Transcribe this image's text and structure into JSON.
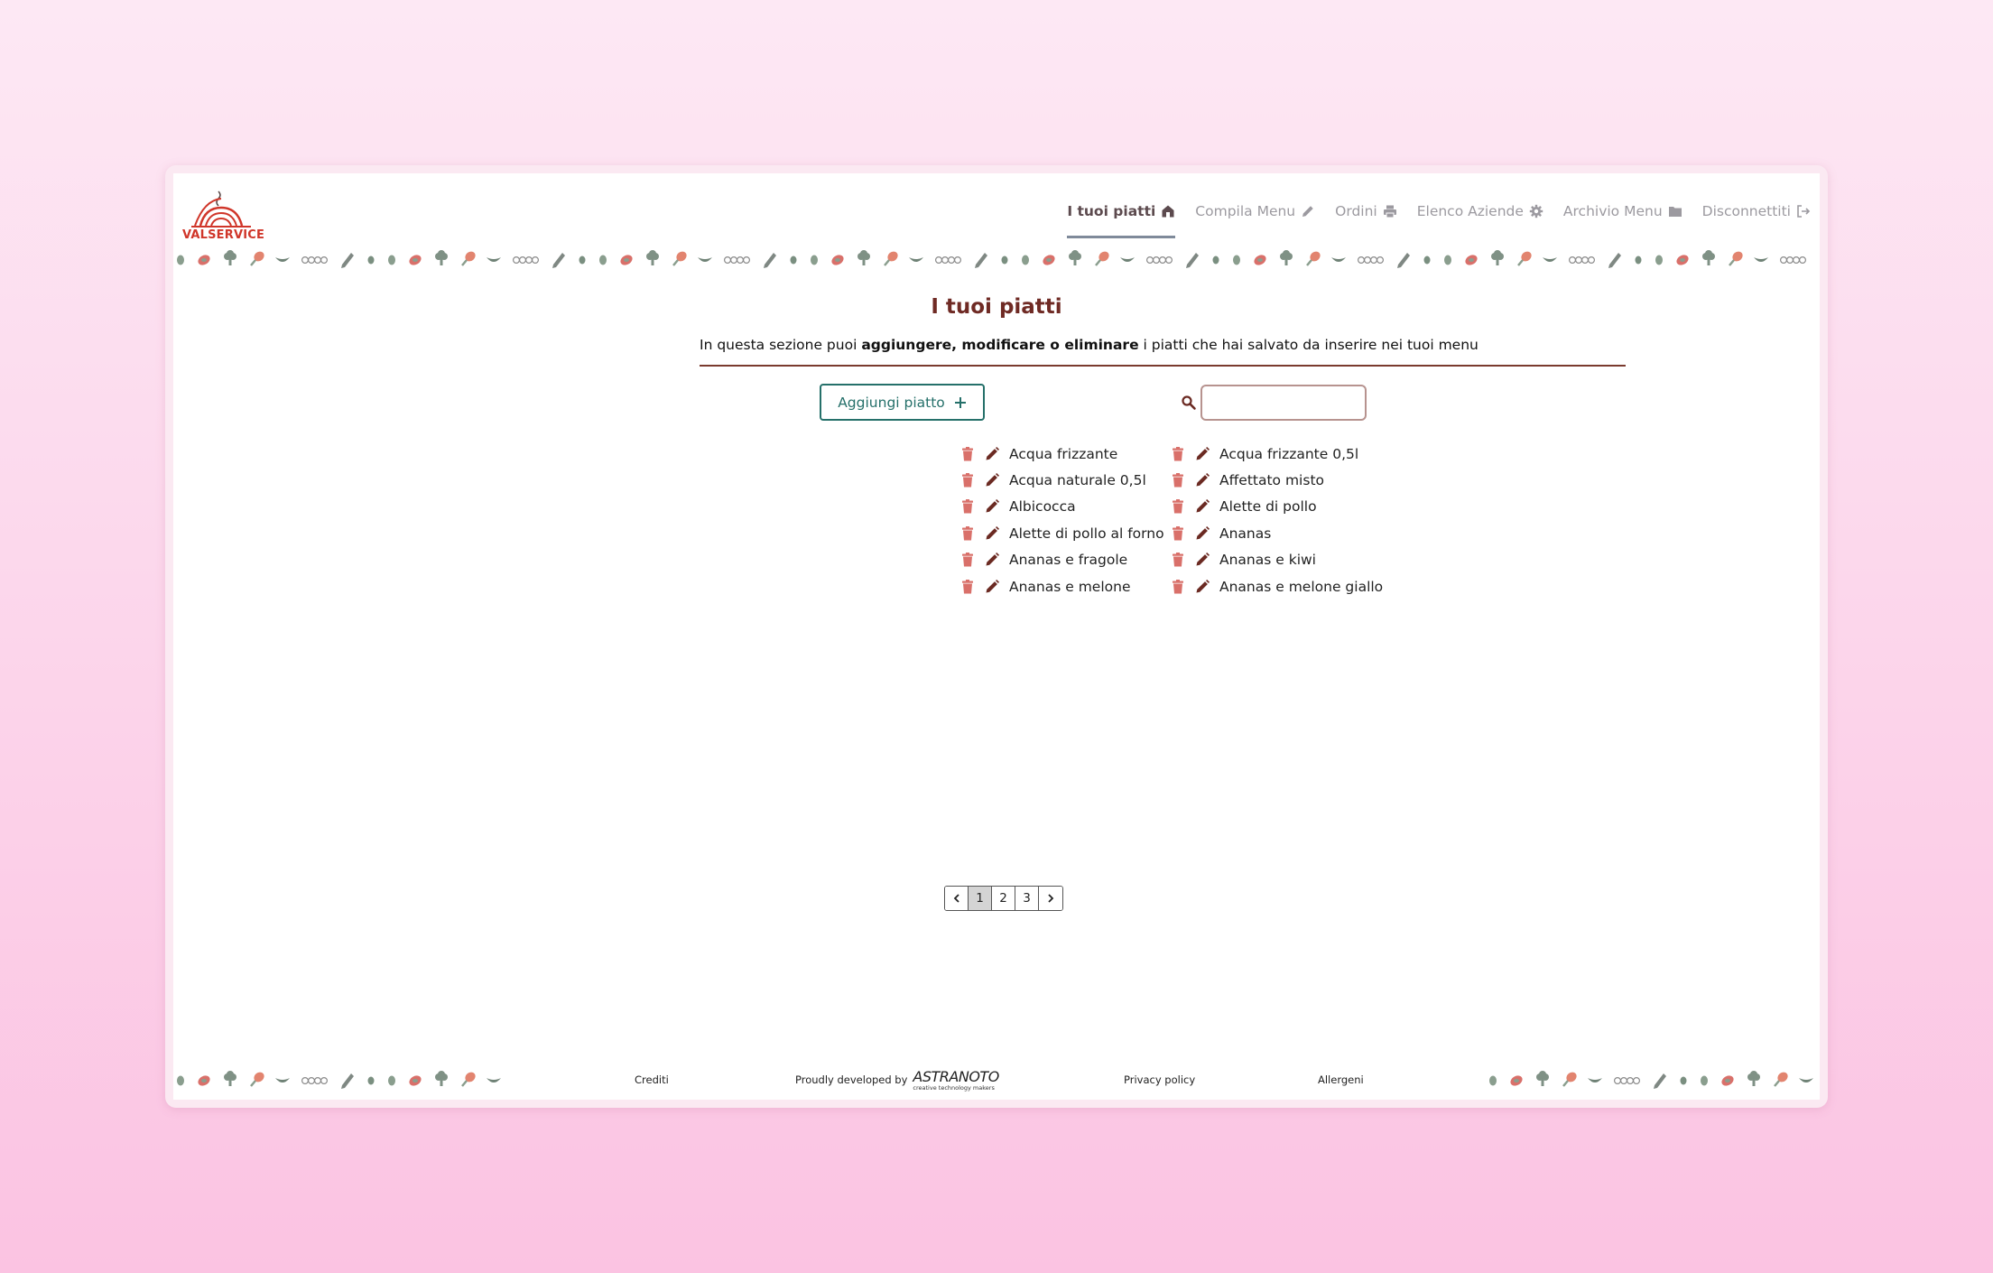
{
  "brand": {
    "name": "VALSERVICE"
  },
  "nav": [
    {
      "label": "I tuoi piatti",
      "icon": "home-icon",
      "active": true
    },
    {
      "label": "Compila Menu",
      "icon": "pencil-icon",
      "active": false
    },
    {
      "label": "Ordini",
      "icon": "printer-icon",
      "active": false
    },
    {
      "label": "Elenco Aziende",
      "icon": "gear-icon",
      "active": false
    },
    {
      "label": "Archivio Menu",
      "icon": "folder-icon",
      "active": false
    },
    {
      "label": "Disconnettiti",
      "icon": "logout-icon",
      "active": false
    }
  ],
  "page": {
    "title": "I tuoi piatti",
    "intro_before": "In questa sezione puoi ",
    "intro_bold": "aggiungere, modificare o eliminare",
    "intro_after": " i piatti che hai salvato da inserire nei tuoi menu"
  },
  "actions": {
    "add_label": "Aggiungi piatto",
    "add_icon": "plus-icon"
  },
  "search": {
    "placeholder": "",
    "value": ""
  },
  "dishes_left": [
    "Acqua frizzante",
    "Acqua naturale 0,5l",
    "Albicocca",
    "Alette di pollo al forno",
    "Ananas e fragole",
    "Ananas e melone"
  ],
  "dishes_right": [
    "Acqua frizzante 0,5l",
    "Affettato misto",
    "Alette di pollo",
    "Ananas",
    "Ananas e kiwi",
    "Ananas e melone giallo"
  ],
  "pagination": {
    "prev_icon": "chevron-left-icon",
    "pages": [
      "1",
      "2",
      "3"
    ],
    "current": "1",
    "next_icon": "chevron-right-icon"
  },
  "footer": {
    "credits": "Crediti",
    "developed_by": "Proudly developed by",
    "developer_logo": "ASTRANOTO",
    "developer_tagline": "creative technology makers",
    "privacy": "Privacy policy",
    "allergens": "Allergeni"
  },
  "colors": {
    "accent_title": "#6f2a24",
    "teal": "#25706a",
    "icon_red": "#d9706a",
    "icon_brown": "#6b2a22",
    "nav_gray": "#9c9aa0"
  }
}
